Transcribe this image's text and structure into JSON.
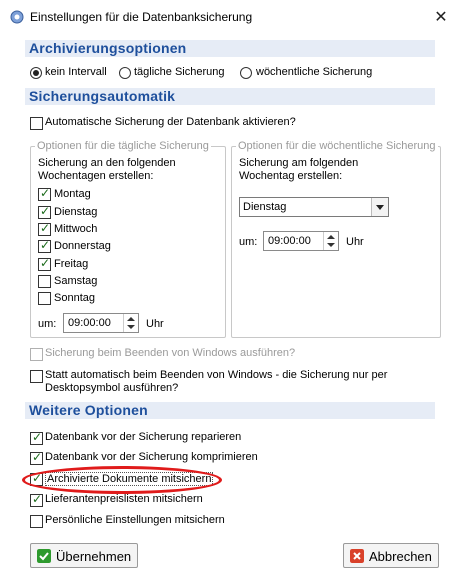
{
  "window": {
    "title": "Einstellungen für die Datenbanksicherung",
    "close": "✕"
  },
  "sections": {
    "archive": "Archivierungsoptionen",
    "auto": "Sicherungsautomatik",
    "more": "Weitere Optionen"
  },
  "radios": [
    {
      "label": "kein Intervall",
      "checked": true
    },
    {
      "label": "tägliche Sicherung",
      "checked": false
    },
    {
      "label": "wöchentliche Sicherung",
      "checked": false
    }
  ],
  "auto_enable": {
    "label": "Automatische Sicherung der Datenbank aktivieren?",
    "checked": false
  },
  "daily": {
    "group_title": "Optionen für die tägliche Sicherung",
    "intro_1": "Sicherung an den folgenden",
    "intro_2": "Wochentagen erstellen:",
    "days": [
      {
        "label": "Montag",
        "checked": true
      },
      {
        "label": "Dienstag",
        "checked": true
      },
      {
        "label": "Mittwoch",
        "checked": true
      },
      {
        "label": "Donnerstag",
        "checked": true
      },
      {
        "label": "Freitag",
        "checked": true
      },
      {
        "label": "Samstag",
        "checked": false
      },
      {
        "label": "Sonntag",
        "checked": false
      }
    ],
    "time_label": "um:",
    "time_value": "09:00:00",
    "time_unit": "Uhr"
  },
  "weekly": {
    "group_title": "Optionen für die wöchentliche Sicherung",
    "intro_1": "Sicherung am folgenden",
    "intro_2": "Wochentag erstellen:",
    "day_value": "Dienstag",
    "time_label": "um:",
    "time_value": "09:00:00",
    "time_unit": "Uhr"
  },
  "windows_shutdown": {
    "label": "Sicherung beim Beenden von Windows ausführen?",
    "checked": false,
    "disabled": true
  },
  "desktop_symbol": {
    "label_1": "Statt automatisch beim Beenden von Windows - die Sicherung nur per",
    "label_2": "Desktopsymbol ausführen?",
    "checked": false
  },
  "more_options": [
    {
      "label": "Datenbank vor der Sicherung reparieren",
      "checked": true
    },
    {
      "label": "Datenbank vor der Sicherung komprimieren",
      "checked": true
    },
    {
      "label": "Archivierte Dokumente mitsichern",
      "checked": true
    },
    {
      "label": "Lieferantenpreislisten mitsichern",
      "checked": true
    },
    {
      "label": "Persönliche Einstellungen mitsichern",
      "checked": false
    }
  ],
  "buttons": {
    "apply": "Übernehmen",
    "cancel": "Abbrechen"
  },
  "colors": {
    "section_bg": "#e6ecf6",
    "section_text": "#1e4f9c",
    "highlight": "#e01b1b",
    "check_green": "#1a6a1a"
  }
}
